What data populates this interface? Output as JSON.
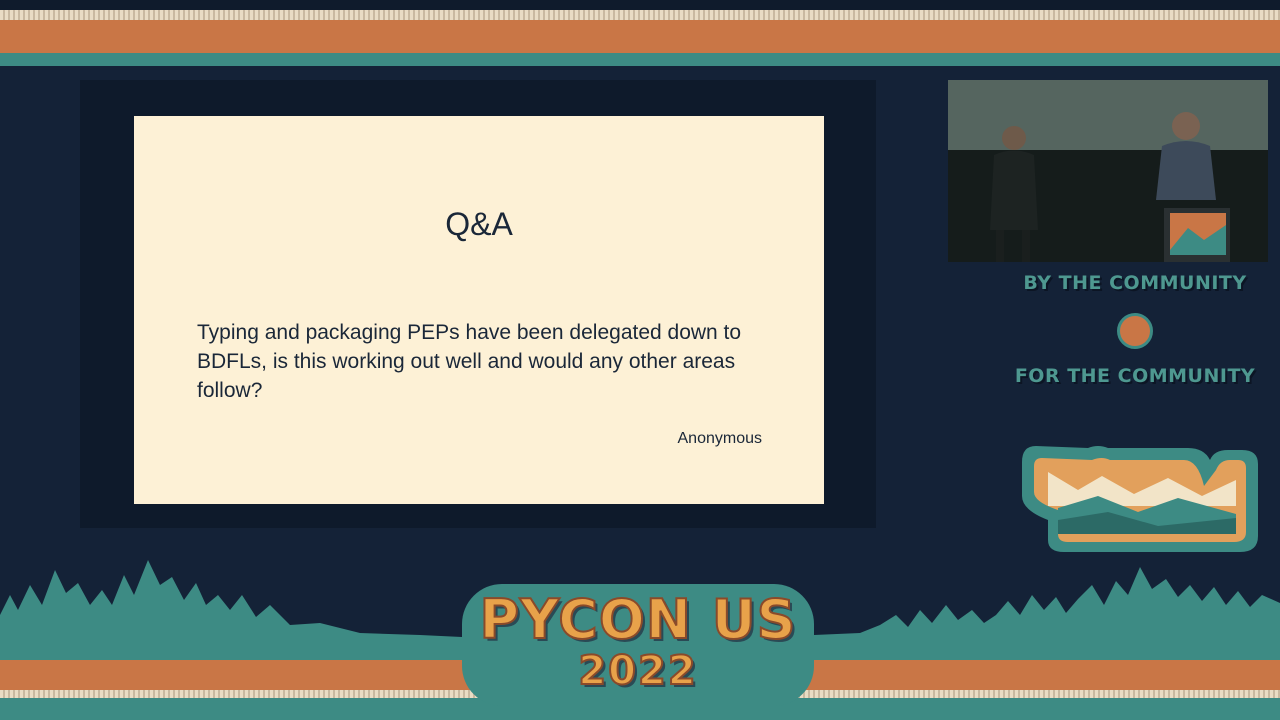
{
  "slide": {
    "title": "Q&A",
    "question": "Typing and packaging PEPs have been delegated down to BDFLs, is this working out well and would any other areas follow?",
    "author": "Anonymous"
  },
  "branding": {
    "tagline_top": "BY THE COMMUNITY",
    "tagline_bottom": "FOR THE COMMUNITY",
    "event_name": "PYCON US",
    "event_year": "2022"
  },
  "colors": {
    "background": "#142237",
    "orange": "#c97646",
    "teal": "#3d8b84",
    "slide": "#fdf1d6"
  }
}
